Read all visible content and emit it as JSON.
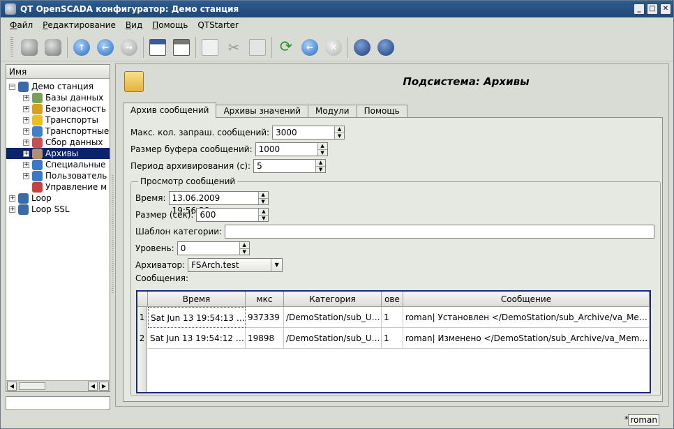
{
  "window": {
    "title": "QT OpenSCADA конфигуратор: Демо станция"
  },
  "menu": [
    "Файл",
    "Редактирование",
    "Вид",
    "Помощь",
    "QTStarter"
  ],
  "toolbar": {
    "icons": [
      "db-load-icon",
      "db-save-icon",
      "up-icon",
      "back-icon",
      "forward-icon",
      "add-item-icon",
      "delete-item-icon",
      "copy-icon",
      "cut-icon",
      "paste-icon",
      "refresh-icon",
      "stop-icon",
      "close-icon",
      "tool-a-icon",
      "tool-b-icon"
    ]
  },
  "tree": {
    "header": "Имя",
    "items": [
      {
        "label": "Демо станция",
        "level": 0,
        "expanded": true,
        "icon_color": "#3a6aa8"
      },
      {
        "label": "Базы данных",
        "level": 1,
        "icon_color": "#7aa05a"
      },
      {
        "label": "Безопасность",
        "level": 1,
        "icon_color": "#d8a020"
      },
      {
        "label": "Транспорты",
        "level": 1,
        "icon_color": "#e8c020"
      },
      {
        "label": "Транспортные",
        "level": 1,
        "icon_color": "#4080c8"
      },
      {
        "label": "Сбор данных",
        "level": 1,
        "icon_color": "#c85050"
      },
      {
        "label": "Архивы",
        "level": 1,
        "selected": true,
        "icon_color": "#b09070"
      },
      {
        "label": "Специальные",
        "level": 1,
        "icon_color": "#3a78c8"
      },
      {
        "label": "Пользователь",
        "level": 1,
        "icon_color": "#3a78c8"
      },
      {
        "label": "Управление м",
        "level": 1,
        "no_expander": true,
        "icon_color": "#c84040"
      },
      {
        "label": "Loop",
        "level": 0,
        "icon_color": "#3a6aa8"
      },
      {
        "label": "Loop SSL",
        "level": 0,
        "icon_color": "#3a6aa8"
      }
    ]
  },
  "page": {
    "title": "Подсистема: Архивы"
  },
  "tabs": [
    "Архив сообщений",
    "Архивы значений",
    "Модули",
    "Помощь"
  ],
  "form": {
    "max_msgs_label": "Макс. кол. запраш. сообщений:",
    "max_msgs_value": "3000",
    "buffer_label": "Размер буфера сообщений:",
    "buffer_value": "1000",
    "period_label": "Период архивирования (с):",
    "period_value": "5"
  },
  "view": {
    "group_title": "Просмотр сообщений",
    "time_label": "Время:",
    "time_value": "13.06.2009 19:56:38",
    "size_label": "Размер (сек):",
    "size_value": "600",
    "category_label": "Шаблон категории:",
    "category_value": "",
    "level_label": "Уровень:",
    "level_value": "0",
    "archiver_label": "Архиватор:",
    "archiver_value": "FSArch.test",
    "messages_label": "Сообщения:"
  },
  "table": {
    "columns": [
      "Время",
      "мкс",
      "Категория",
      "ове",
      "Сообщение"
    ],
    "rows": [
      {
        "n": "1",
        "cells": [
          "Sat Jun 13 19:54:13 2...",
          "937339",
          "/DemoStation/sub_UI...",
          "1",
          "roman| Установлен </DemoStation/sub_Archive/va_MemInf..."
        ]
      },
      {
        "n": "2",
        "cells": [
          "Sat Jun 13 19:54:12 2...",
          "19898",
          "/DemoStation/sub_UI...",
          "1",
          "roman| Изменено </DemoStation/sub_Archive/va_MemInfo..."
        ]
      }
    ]
  },
  "status": {
    "modified": "*",
    "user": "roman"
  }
}
